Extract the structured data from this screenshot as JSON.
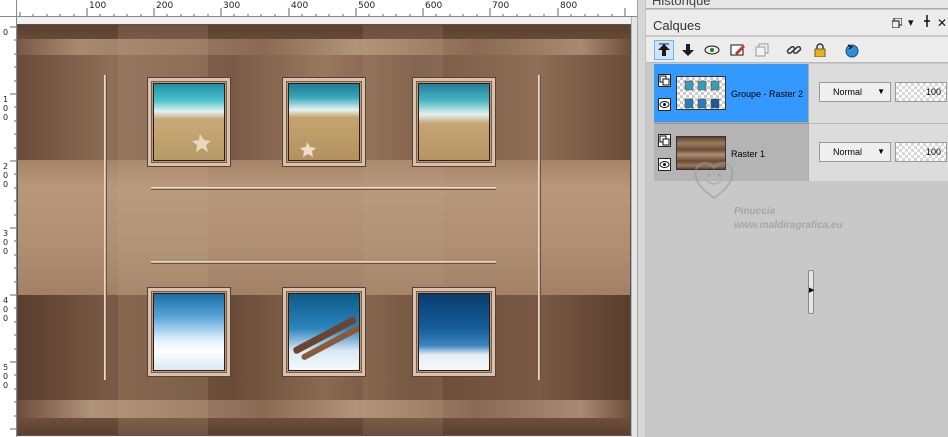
{
  "ruler": {
    "top_labels": [
      "100",
      "200",
      "300",
      "400",
      "500",
      "600",
      "700",
      "800"
    ],
    "left_labels": [
      "0",
      "1\n0\n0",
      "2\n0\n0",
      "3\n0\n0",
      "4\n0\n0",
      "5\n0\n0"
    ]
  },
  "panel": {
    "historique_title": "Historique",
    "calques_title": "Calques",
    "layers": [
      {
        "name": "Groupe - Raster 2",
        "blend_mode": "Normal",
        "opacity": "100",
        "selected": true
      },
      {
        "name": "Raster 1",
        "blend_mode": "Normal",
        "opacity": "100",
        "selected": false
      }
    ]
  },
  "watermark": {
    "name": "Pinuccia",
    "site": "www.maldiragrafica.eu"
  },
  "colors": {
    "selection": "#3399ff",
    "artwork_brown": "#8a6a52"
  },
  "icons": {
    "toolbar": [
      "move-layer-up-icon",
      "move-layer-down-icon",
      "visibility-icon",
      "edit-icon",
      "duplicate-icon",
      "link-icon",
      "lock-icon",
      "reset-icon"
    ]
  }
}
